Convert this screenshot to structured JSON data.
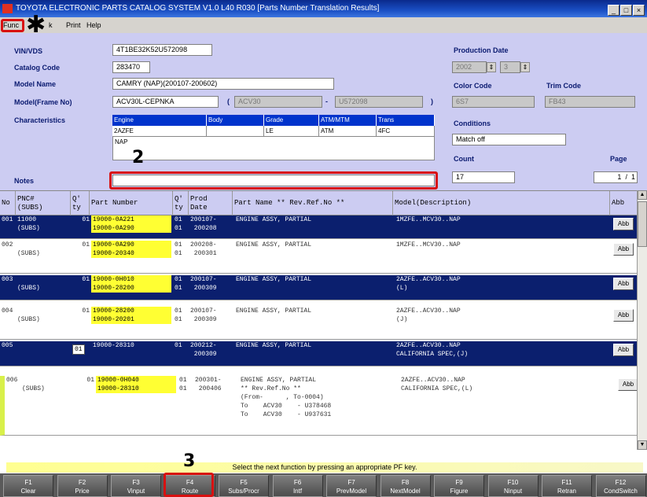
{
  "window": {
    "title": "TOYOTA ELECTRONIC PARTS CATALOG SYSTEM V1.0 L40 R030 [Parts  Number Translation Results]",
    "buttons": [
      "_",
      "□",
      "×"
    ]
  },
  "menu": {
    "func": "Func",
    "back": "k",
    "print": "Print",
    "help": "Help"
  },
  "callouts": {
    "asterisk": "✱",
    "two": "2",
    "three": "3"
  },
  "vehicle": {
    "vin_label": "VIN/VDS",
    "vin": "4T1BE32K52U572098",
    "catalog_label": "Catalog Code",
    "catalog": "283470",
    "model_label": "Model Name",
    "model": "CAMRY        (NAP)(200107-200602)",
    "frame_label": "Model(Frame No)",
    "frame": "ACV30L-CEPNKA",
    "frame_open": "(",
    "frame_code": "ACV30",
    "frame_dash": "-",
    "frame_serial": "U572098",
    "frame_close": ")",
    "char_label": "Characteristics",
    "char_headers": [
      "Engine",
      "Body",
      "Grade",
      "ATM/MTM",
      "Trans"
    ],
    "char_values": [
      "2AZFE",
      "",
      "LE",
      "ATM",
      "4FC"
    ],
    "char_extra": "NAP",
    "notes_label": "Notes",
    "notes": ""
  },
  "right": {
    "prod_label": "Production Date",
    "prod_year": "2002",
    "prod_month": "3",
    "color_label": "Color Code",
    "color": "6S7",
    "trim_label": "Trim Code",
    "trim": "FB43",
    "cond_label": "Conditions",
    "cond": "Match off",
    "count_label": "Count",
    "count": "17",
    "page_label": "Page",
    "page_current": "1",
    "page_sep": "/",
    "page_total": "1"
  },
  "table": {
    "headers": {
      "no": "No",
      "pnc": "PNC#\n(SUBS)",
      "qty": "Q'\nty",
      "part": "Part Number",
      "qty2": "Q'\nty",
      "prod": "Prod\nDate",
      "name": "Part Name ** Rev.Ref.No **",
      "model": "Model(Description)",
      "abb": "Abb"
    },
    "rows": [
      {
        "no": "001",
        "pnc": "11000\n(SUBS)",
        "qty": "01",
        "parts": [
          "19000-0A221",
          "19000-0A290"
        ],
        "qty2": "01\n01",
        "prod": "200107-\n 200208",
        "name": "ENGINE ASSY, PARTIAL",
        "model": "1MZFE..MCV30..NAP",
        "abb": "Abb"
      },
      {
        "no": "002",
        "pnc": "\n(SUBS)",
        "qty": "01",
        "parts": [
          "19000-0A290",
          "19000-20340"
        ],
        "qty2": "01\n01",
        "prod": "200208-\n 200301",
        "name": "ENGINE ASSY, PARTIAL",
        "model": "1MZFE..MCV30..NAP",
        "abb": "Abb"
      },
      {
        "no": "003",
        "pnc": "\n(SUBS)",
        "qty": "01",
        "parts": [
          "19000-0H010",
          "19000-28200"
        ],
        "qty2": "01\n01",
        "prod": "200107-\n 200309",
        "name": "ENGINE ASSY, PARTIAL",
        "model": "2AZFE..ACV30..NAP\n(L)",
        "abb": "Abb"
      },
      {
        "no": "004",
        "pnc": "\n(SUBS)",
        "qty": "01",
        "parts": [
          "19000-28200",
          "19000-20201"
        ],
        "qty2": "01\n01",
        "prod": "200107-\n 200309",
        "name": "ENGINE ASSY, PARTIAL",
        "model": "2AZFE..ACV30..NAP\n(J)",
        "abb": "Abb"
      },
      {
        "no": "005",
        "pnc": "",
        "qty": "01",
        "parts": [
          "19000-28310"
        ],
        "qty2": "01",
        "prod": "200212-\n 200309",
        "name": "ENGINE ASSY, PARTIAL",
        "model": "2AZFE..ACV30..NAP\nCALIFORNIA SPEC,(J)",
        "abb": "Abb"
      },
      {
        "no": "006",
        "pnc": "\n(SUBS)",
        "qty": "01",
        "parts": [
          "19000-0H040",
          "19000-28310"
        ],
        "qty2": "01\n01",
        "prod": "200301-\n 200406",
        "name": "ENGINE ASSY, PARTIAL\n** Rev.Ref.No **\n(From-      , To-0004)\nTo    ACV30    - U378468\nTo    ACV30    - U937631",
        "model": "2AZFE..ACV30..NAP\nCALIFORNIA SPEC,(L)",
        "abb": "Abb"
      }
    ]
  },
  "status": {
    "message": "Select the next function by pressing an appropriate PF key."
  },
  "fkeys": [
    {
      "key": "F1",
      "label": "Clear"
    },
    {
      "key": "F2",
      "label": "Price"
    },
    {
      "key": "F3",
      "label": "Vinput"
    },
    {
      "key": "F4",
      "label": "Route"
    },
    {
      "key": "F5",
      "label": "Subs/Procr"
    },
    {
      "key": "F6",
      "label": "Intf"
    },
    {
      "key": "F7",
      "label": "PrevModel"
    },
    {
      "key": "F8",
      "label": "NextModel"
    },
    {
      "key": "F9",
      "label": "Figure"
    },
    {
      "key": "F10",
      "label": "Ninput"
    },
    {
      "key": "F11",
      "label": "Retran"
    },
    {
      "key": "F12",
      "label": "CondSwitch"
    }
  ]
}
